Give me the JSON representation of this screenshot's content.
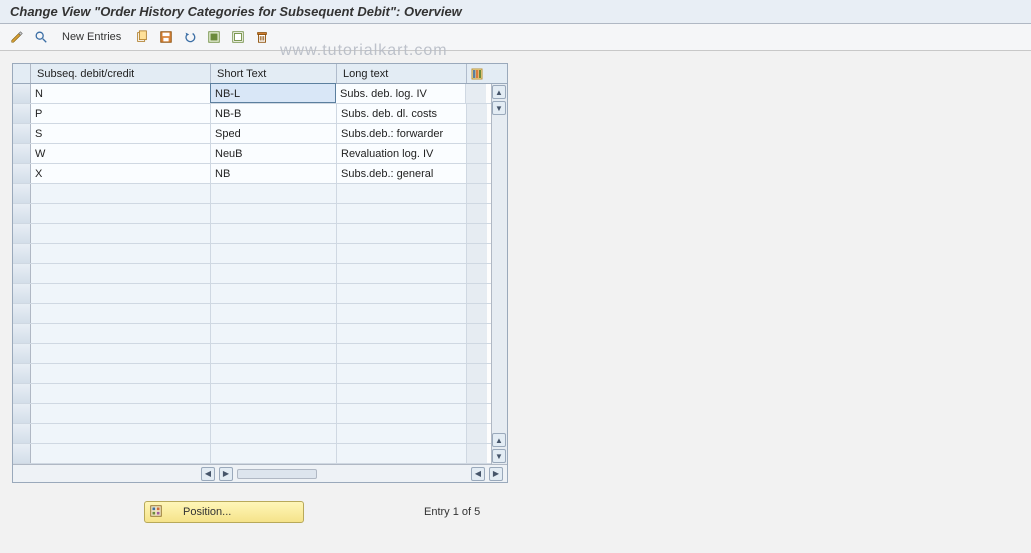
{
  "title": "Change View \"Order History Categories for Subsequent Debit\": Overview",
  "toolbar": {
    "new_entries_label": "New Entries"
  },
  "watermark": "www.tutorialkart.com",
  "table": {
    "columns": {
      "c1": "Subseq. debit/credit",
      "c2": "Short Text",
      "c3": "Long text"
    },
    "rows": [
      {
        "c1": "N",
        "c2": "NB-L",
        "c3": "Subs. deb. log. IV"
      },
      {
        "c1": "P",
        "c2": "NB-B",
        "c3": "Subs. deb. dl. costs"
      },
      {
        "c1": "S",
        "c2": "Sped",
        "c3": "Subs.deb.: forwarder"
      },
      {
        "c1": "W",
        "c2": "NeuB",
        "c3": "Revaluation log. IV"
      },
      {
        "c1": "X",
        "c2": "NB",
        "c3": "Subs.deb.: general"
      }
    ]
  },
  "footer": {
    "position_button": "Position...",
    "entry_text": "Entry 1 of 5"
  }
}
